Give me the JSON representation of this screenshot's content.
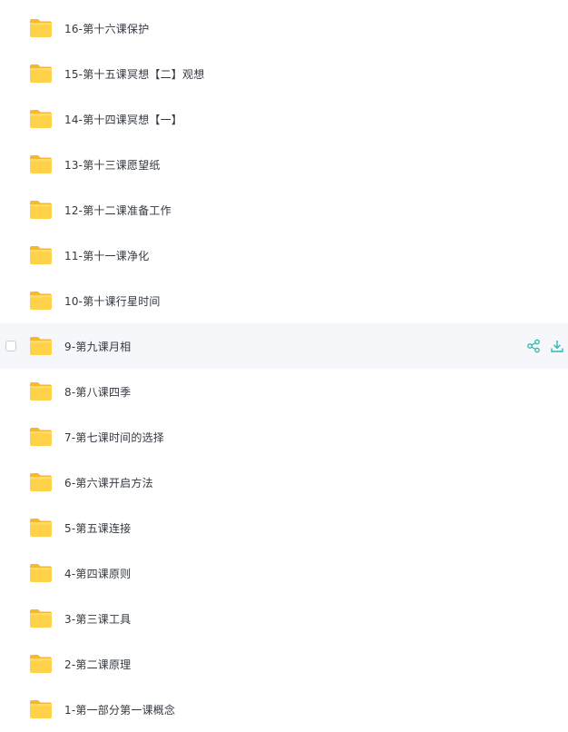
{
  "files": [
    {
      "name": "16-第十六课保护",
      "hovered": false
    },
    {
      "name": "15-第十五课冥想【二】观想",
      "hovered": false
    },
    {
      "name": "14-第十四课冥想【一】",
      "hovered": false
    },
    {
      "name": "13-第十三课愿望纸",
      "hovered": false
    },
    {
      "name": "12-第十二课准备工作",
      "hovered": false
    },
    {
      "name": "11-第十一课净化",
      "hovered": false
    },
    {
      "name": "10-第十课行星时间",
      "hovered": false
    },
    {
      "name": "9-第九课月相",
      "hovered": true
    },
    {
      "name": "8-第八课四季",
      "hovered": false
    },
    {
      "name": "7-第七课时间的选择",
      "hovered": false
    },
    {
      "name": "6-第六课开启方法",
      "hovered": false
    },
    {
      "name": "5-第五课连接",
      "hovered": false
    },
    {
      "name": "4-第四课原则",
      "hovered": false
    },
    {
      "name": "3-第三课工具",
      "hovered": false
    },
    {
      "name": "2-第二课原理",
      "hovered": false
    },
    {
      "name": "1-第一部分第一课概念",
      "hovered": false
    }
  ],
  "icons": {
    "folder": "folder-icon",
    "share": "share-icon",
    "download": "download-icon"
  },
  "colors": {
    "folder_body": "#FFD24A",
    "folder_tab": "#F5B82E",
    "action_accent": "#2FB8B0",
    "hover_bg": "#F5F7FB"
  }
}
